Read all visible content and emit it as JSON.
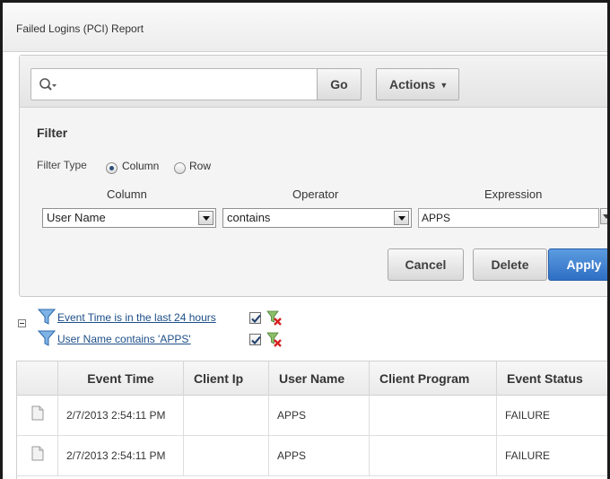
{
  "region": {
    "title": "Failed Logins (PCI) Report"
  },
  "toolbar": {
    "search_value": "",
    "go_label": "Go",
    "actions_label": "Actions"
  },
  "filter": {
    "title": "Filter",
    "type_label": "Filter Type",
    "type_options": [
      "Column",
      "Row"
    ],
    "type_selected": "Column",
    "column_header": "Column",
    "operator_header": "Operator",
    "expression_header": "Expression",
    "column_value": "User Name",
    "operator_value": "contains",
    "expression_value": "APPS",
    "buttons": {
      "cancel": "Cancel",
      "delete": "Delete",
      "apply": "Apply"
    }
  },
  "active_filters": [
    {
      "label": "Event Time is in the last 24 hours",
      "enabled": true
    },
    {
      "label": "User Name contains 'APPS'",
      "enabled": true
    }
  ],
  "table": {
    "columns": [
      "",
      "Event Time",
      "Client Ip",
      "User Name",
      "Client Program",
      "Event Status"
    ],
    "rows": [
      [
        "",
        "2/7/2013 2:54:11 PM",
        "",
        "APPS",
        "",
        "FAILURE"
      ],
      [
        "",
        "2/7/2013 2:54:11 PM",
        "",
        "APPS",
        "",
        "FAILURE"
      ]
    ]
  },
  "colors": {
    "primary_button": "#3a7dd1",
    "link": "#1d4f88",
    "remove_icon": "#d62020",
    "funnel": "#3b7fc4"
  },
  "icons": {
    "search": "search-icon",
    "funnel": "funnel-icon",
    "remove": "remove-filter-icon",
    "row": "document-icon",
    "collapse": "collapse-icon"
  }
}
